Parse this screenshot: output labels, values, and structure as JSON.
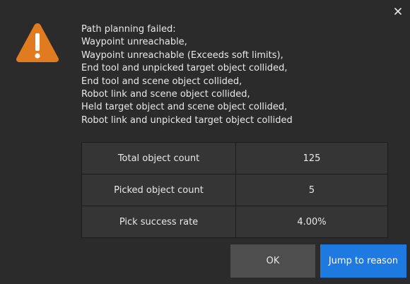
{
  "dialog": {
    "close_glyph": "✕",
    "icon": "warning-triangle-icon",
    "icon_color": "#e07b1f",
    "message_lines": [
      "Path planning failed:",
      "Waypoint unreachable,",
      "Waypoint unreachable (Exceeds soft limits),",
      "End tool and unpicked target object collided,",
      "End tool and scene object collided,",
      "Robot link and scene object collided,",
      "Held target object and scene object collided,",
      "Robot link and unpicked target object collided"
    ],
    "stats": [
      {
        "label": "Total object count",
        "value": "125"
      },
      {
        "label": "Picked object count",
        "value": "5"
      },
      {
        "label": "Pick success rate",
        "value": "4.00%"
      }
    ],
    "buttons": {
      "ok_label": "OK",
      "jump_label": "Jump to reason",
      "jump_color": "#1e7ae0"
    }
  }
}
